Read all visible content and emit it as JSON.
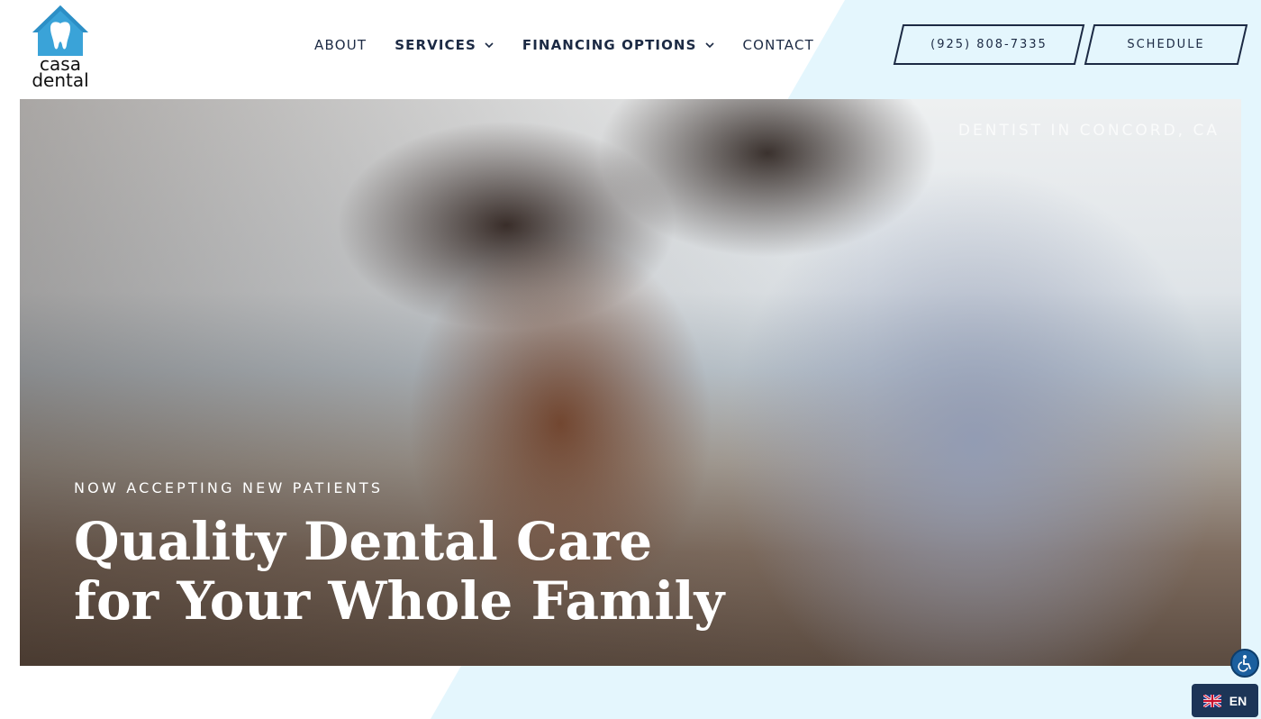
{
  "brand": {
    "name_line1": "casa",
    "name_line2": "dental",
    "logo_icon": "house-tooth-icon",
    "accent_color": "#3aa3d8"
  },
  "nav": {
    "items": [
      {
        "label": "ABOUT",
        "has_dropdown": false
      },
      {
        "label": "SERVICES",
        "has_dropdown": true
      },
      {
        "label": "FINANCING OPTIONS",
        "has_dropdown": true
      },
      {
        "label": "CONTACT",
        "has_dropdown": false
      }
    ]
  },
  "header_actions": {
    "phone_label": "(925) 808-7335",
    "schedule_label": "SCHEDULE"
  },
  "hero": {
    "location_text": "DENTIST IN CONCORD, CA",
    "eyebrow": "NOW ACCEPTING NEW PATIENTS",
    "title_line1": "Quality Dental Care",
    "title_line2": "for Your Whole Family"
  },
  "widgets": {
    "accessibility_icon": "wheelchair-icon",
    "language_label": "EN",
    "language_flag": "uk-flag-icon"
  },
  "colors": {
    "navy": "#1c2a44",
    "slant_background": "#e4f6fd",
    "language_button": "#1d3557"
  }
}
